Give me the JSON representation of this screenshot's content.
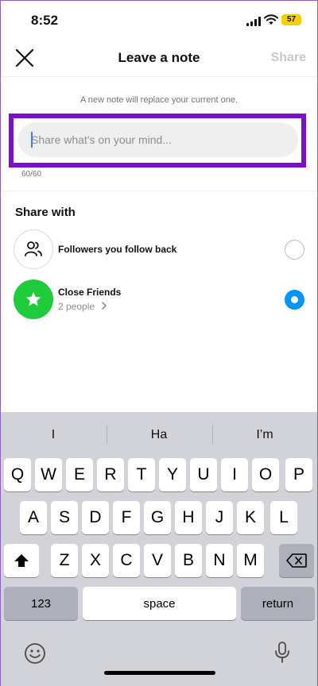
{
  "status": {
    "time": "8:52",
    "battery": "57"
  },
  "nav": {
    "title": "Leave a note",
    "share_label": "Share"
  },
  "note": {
    "hint": "A new note will replace your current one.",
    "placeholder": "Share what's on your mind...",
    "counter": "60/60"
  },
  "share_with": {
    "title": "Share with",
    "options": [
      {
        "label": "Followers you follow back",
        "selected": false,
        "icon": "people-icon"
      },
      {
        "label": "Close Friends",
        "sub": "2 people",
        "selected": true,
        "icon": "star-icon"
      }
    ]
  },
  "keyboard": {
    "suggestions": [
      "I",
      "Ha",
      "I’m"
    ],
    "row1": [
      "Q",
      "W",
      "E",
      "R",
      "T",
      "Y",
      "U",
      "I",
      "O",
      "P"
    ],
    "row2": [
      "A",
      "S",
      "D",
      "F",
      "G",
      "H",
      "J",
      "K",
      "L"
    ],
    "row3": [
      "Z",
      "X",
      "C",
      "V",
      "B",
      "N",
      "M"
    ],
    "numbers_label": "123",
    "space_label": "space",
    "return_label": "return"
  },
  "colors": {
    "accent": "#0095f6",
    "highlight": "#7a11c9",
    "close_friends": "#1ecb3a",
    "battery": "#f5d000"
  }
}
